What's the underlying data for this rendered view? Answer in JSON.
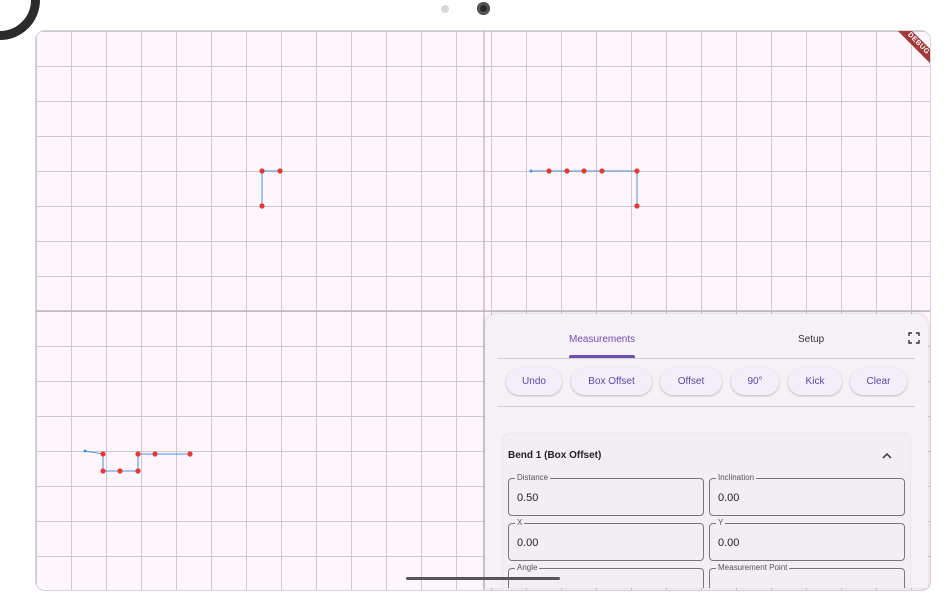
{
  "debug_banner": "DEBUG",
  "panel": {
    "tabs": [
      {
        "label": "Measurements",
        "active": true
      },
      {
        "label": "Setup",
        "active": false
      }
    ],
    "buttons": [
      {
        "label": "Undo"
      },
      {
        "label": "Box Offset"
      },
      {
        "label": "Offset"
      },
      {
        "label": "90°"
      },
      {
        "label": "Kick"
      },
      {
        "label": "Clear"
      }
    ],
    "bend": {
      "title": "Bend 1 (Box Offset)",
      "fields": [
        {
          "label": "Distance",
          "value": "0.50"
        },
        {
          "label": "Inclination",
          "value": "0.00"
        },
        {
          "label": "X",
          "value": "0.00"
        },
        {
          "label": "Y",
          "value": "0.00"
        },
        {
          "label": "Angle",
          "value": ""
        },
        {
          "label": "Measurement Point",
          "value": ""
        }
      ]
    }
  },
  "colors": {
    "line": "#4a90e2",
    "point": "#e53935",
    "accent": "#6a4fb0"
  }
}
